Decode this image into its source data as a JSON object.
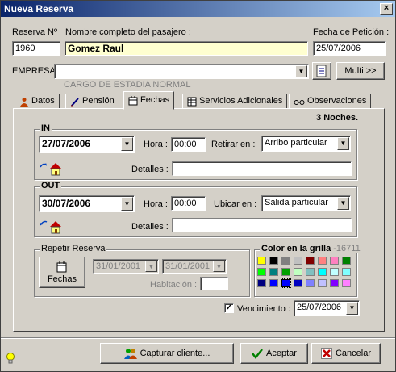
{
  "window": {
    "title": "Nueva Reserva",
    "close_glyph": "×"
  },
  "header": {
    "reserva_label": "Reserva Nº",
    "reserva_value": "1960",
    "pasajero_label": "Nombre completo del pasajero :",
    "pasajero_value": "Gomez Raul",
    "fecha_label": "Fecha de Petición :",
    "fecha_value": "25/07/2006",
    "empresa_label": "EMPRESA :",
    "empresa_value": "",
    "multi_label": "Multi >>",
    "cargo_text": "CARGO DE ESTADIA NORMAL"
  },
  "tabs": [
    {
      "label": "Datos",
      "icon": "person-icon"
    },
    {
      "label": "Pensión",
      "icon": "pen-icon"
    },
    {
      "label": "Fechas",
      "icon": "calendar-icon"
    },
    {
      "label": "Servicios Adicionales",
      "icon": "grid-icon"
    },
    {
      "label": "Observaciones",
      "icon": "glasses-icon"
    }
  ],
  "fechas": {
    "noches": "3 Noches.",
    "in": {
      "title": "IN",
      "date": "27/07/2006",
      "hora_label": "Hora :",
      "hora_value": "00:00",
      "retirar_label": "Retirar en :",
      "retirar_value": "Arribo particular",
      "detalles_label": "Detalles :",
      "detalles_value": ""
    },
    "out": {
      "title": "OUT",
      "date": "30/07/2006",
      "hora_label": "Hora :",
      "hora_value": "00:00",
      "ubicar_label": "Ubicar en :",
      "ubicar_value": "Salida particular",
      "detalles_label": "Detalles :",
      "detalles_value": ""
    },
    "repetir": {
      "title": "Repetir Reserva",
      "button_label": "Fechas",
      "date_from": "31/01/2001",
      "date_to": "31/01/2001",
      "habitacion_label": "Habitación :",
      "habitacion_value": ""
    },
    "color": {
      "title": "Color en la grilla",
      "code": "-16711",
      "swatches": [
        "#ffff00",
        "#000000",
        "#808080",
        "#c0c0c0",
        "#800000",
        "#ff8080",
        "#ff80c0",
        "#008000",
        "#00ff00",
        "#008080",
        "#00a000",
        "#c0ffc0",
        "#80c0c0",
        "#00ffff",
        "#c0ffff",
        "#80ffff",
        "#000080",
        "#0000ff",
        "#0000ff",
        "#0000c0",
        "#8080ff",
        "#c0c0ff",
        "#8000ff",
        "#ff80ff"
      ]
    },
    "vencimiento_label": "Vencimiento :",
    "vencimiento_value": "25/07/2006",
    "vencimiento_checked": "✓"
  },
  "footer": {
    "capturar_label": "Capturar cliente...",
    "aceptar_label": "Aceptar",
    "cancelar_label": "Cancelar"
  }
}
